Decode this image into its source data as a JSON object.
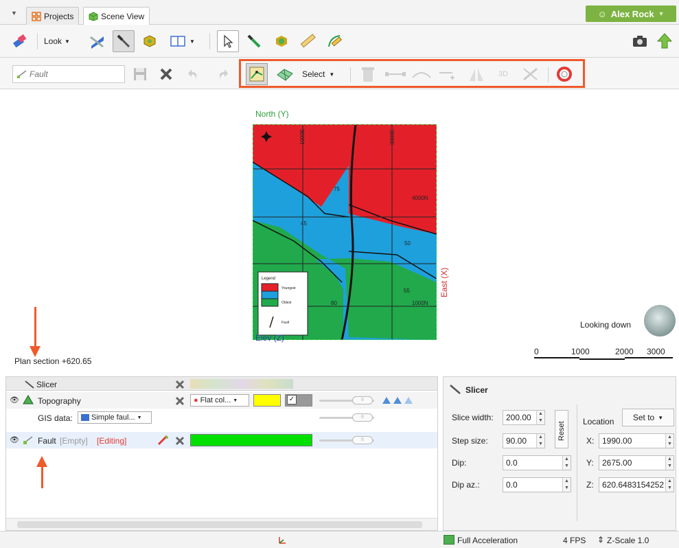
{
  "tabs": [
    {
      "label": "Projects"
    },
    {
      "label": "Scene View"
    }
  ],
  "user": {
    "name": "Alex Rock"
  },
  "toolbar1": {
    "look_label": "Look"
  },
  "toolbar2": {
    "fault_placeholder": "Fault",
    "select_label": "Select"
  },
  "scene": {
    "north_label": "North (Y)",
    "east_label": "East (X)",
    "elev_label": "Elev (Z)",
    "grid_labels": [
      "1000E",
      "3000E",
      "4000N",
      "1000N"
    ],
    "dip_labels": [
      "75",
      "45",
      "50",
      "45",
      "55",
      "80"
    ],
    "legend": {
      "title": "Legend",
      "items": [
        "Youngest",
        "Oldest",
        "Fault"
      ]
    },
    "looking_label": "Looking down",
    "scale_ticks": [
      "0",
      "1000",
      "2000",
      "3000"
    ],
    "plan_section": "Plan section +620.65",
    "colors": {
      "red": "#e3202a",
      "blue": "#1ea0dc",
      "green": "#21a94c",
      "fault_box": "#2ecc40"
    }
  },
  "objects_panel": {
    "header": "Slicer",
    "rows": [
      {
        "name": "Topography",
        "colour_mode": "Flat col..."
      },
      {
        "label": "GIS data:",
        "value": "Simple faul..."
      },
      {
        "name": "Fault",
        "empty": "[Empty]",
        "editing": "[Editing]"
      }
    ],
    "swatches": {
      "topo": "#ffff00",
      "fault": "#00e000"
    }
  },
  "slicer_panel": {
    "title": "Slicer",
    "slice_width_label": "Slice width:",
    "slice_width": "200.00",
    "step_size_label": "Step size:",
    "step_size": "90.00",
    "dip_label": "Dip:",
    "dip": "0.0",
    "dip_az_label": "Dip az.:",
    "dip_az": "0.0",
    "reset_label": "Reset",
    "location_label": "Location",
    "set_to_label": "Set to",
    "x_label": "X:",
    "x": "1990.00",
    "y_label": "Y:",
    "y": "2675.00",
    "z_label": "Z:",
    "z": "620.6483154252"
  },
  "statusbar": {
    "accel": "Full Acceleration",
    "fps": "4 FPS",
    "zscale": "Z-Scale 1.0"
  }
}
